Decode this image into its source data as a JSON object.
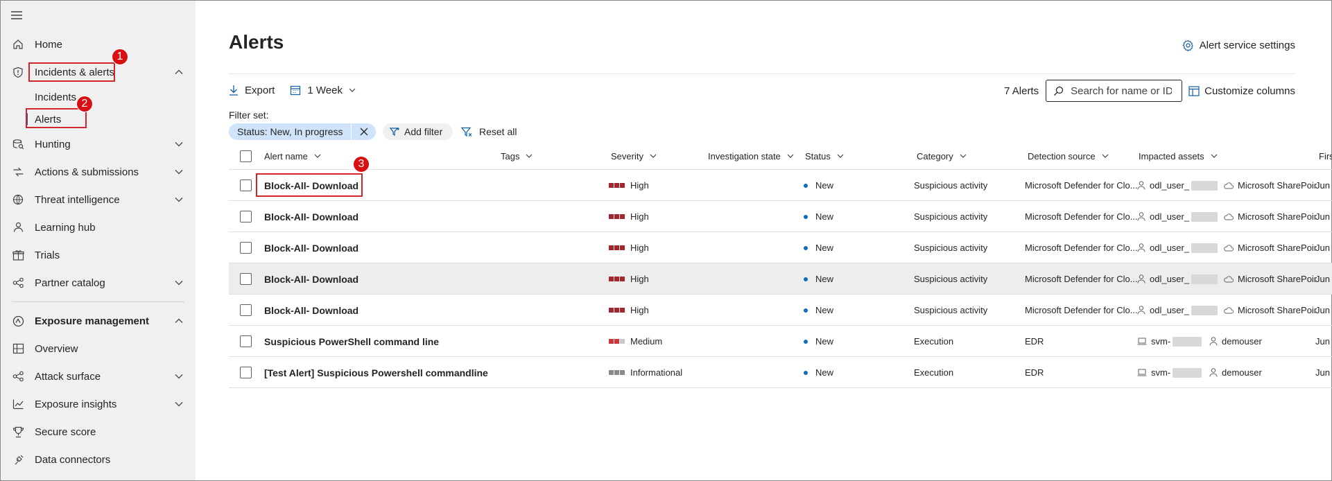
{
  "sidebar": {
    "items": [
      {
        "label": "Home",
        "icon": "home-icon"
      },
      {
        "label": "Incidents & alerts",
        "icon": "shield-icon",
        "expanded": true
      },
      {
        "label": "Incidents"
      },
      {
        "label": "Alerts",
        "selected": true
      },
      {
        "label": "Hunting",
        "icon": "hunting-icon"
      },
      {
        "label": "Actions & submissions",
        "icon": "actions-icon"
      },
      {
        "label": "Threat intelligence",
        "icon": "threat-intel-icon"
      },
      {
        "label": "Learning hub",
        "icon": "learning-icon"
      },
      {
        "label": "Trials",
        "icon": "trials-icon"
      },
      {
        "label": "Partner catalog",
        "icon": "partner-icon"
      },
      {
        "label": "Exposure management",
        "expanded": true
      },
      {
        "label": "Overview",
        "icon": "overview-icon"
      },
      {
        "label": "Attack surface",
        "icon": "attack-surface-icon"
      },
      {
        "label": "Exposure insights",
        "icon": "insights-icon"
      },
      {
        "label": "Secure score",
        "icon": "trophy-icon"
      },
      {
        "label": "Data connectors",
        "icon": "connector-icon"
      }
    ]
  },
  "annotations": [
    "1",
    "2",
    "3"
  ],
  "header": {
    "title": "Alerts",
    "settings_label": "Alert service settings"
  },
  "toolbar": {
    "export_label": "Export",
    "range_label": "1 Week",
    "alert_count": "7 Alerts",
    "search_placeholder": "Search for name or ID",
    "customize_label": "Customize columns"
  },
  "filters": {
    "set_label": "Filter set:",
    "status_pill": "Status: New, In progress",
    "add_filter": "Add filter",
    "reset_all": "Reset all"
  },
  "table": {
    "columns": [
      "Alert name",
      "Tags",
      "Severity",
      "Investigation state",
      "Status",
      "Category",
      "Detection source",
      "Impacted assets",
      "Firs"
    ],
    "rows": [
      {
        "name": "Block-All- Download",
        "severity": "High",
        "status": "New",
        "category": "Suspicious activity",
        "source": "Microsoft Defender for Clo...",
        "asset1": "odl_user_",
        "asset2": "Microsoft SharePoir",
        "first": "Jun"
      },
      {
        "name": "Block-All- Download",
        "severity": "High",
        "status": "New",
        "category": "Suspicious activity",
        "source": "Microsoft Defender for Clo...",
        "asset1": "odl_user_",
        "asset2": "Microsoft SharePoir",
        "first": "Jun"
      },
      {
        "name": "Block-All- Download",
        "severity": "High",
        "status": "New",
        "category": "Suspicious activity",
        "source": "Microsoft Defender for Clo...",
        "asset1": "odl_user_",
        "asset2": "Microsoft SharePoir",
        "first": "Jun"
      },
      {
        "name": "Block-All- Download",
        "severity": "High",
        "status": "New",
        "category": "Suspicious activity",
        "source": "Microsoft Defender for Clo...",
        "asset1": "odl_user_",
        "asset2": "Microsoft SharePoir",
        "first": "Jun"
      },
      {
        "name": "Block-All- Download",
        "severity": "High",
        "status": "New",
        "category": "Suspicious activity",
        "source": "Microsoft Defender for Clo...",
        "asset1": "odl_user_",
        "asset2": "Microsoft SharePoir",
        "first": "Jun"
      },
      {
        "name": "Suspicious PowerShell command line",
        "severity": "Medium",
        "status": "New",
        "category": "Execution",
        "source": "EDR",
        "asset1": "svm-",
        "asset2": "demouser",
        "first": "Jun"
      },
      {
        "name": "[Test Alert] Suspicious Powershell commandline",
        "severity": "Informational",
        "status": "New",
        "category": "Execution",
        "source": "EDR",
        "asset1": "svm-",
        "asset2": "demouser",
        "first": "Jun"
      }
    ]
  },
  "colors": {
    "severity_high": "#a4262c",
    "severity_medium": "#d13438",
    "severity_info": "#8a8a8a",
    "status_new": "#0f6cbd",
    "annotation": "#d90f13",
    "accent": "#115ea3"
  }
}
